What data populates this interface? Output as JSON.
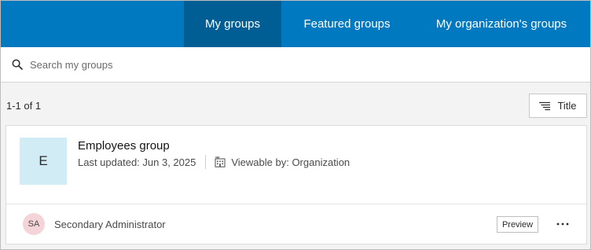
{
  "tabs": [
    {
      "label": "My groups",
      "active": true
    },
    {
      "label": "Featured groups",
      "active": false
    },
    {
      "label": "My organization's groups",
      "active": false
    }
  ],
  "search": {
    "placeholder": "Search my groups",
    "value": "",
    "icon": "search-icon"
  },
  "results": {
    "count_text": "1-1 of 1",
    "sort_label": "Title",
    "sort_icon": "sort-lines-icon"
  },
  "group": {
    "thumbnail_letter": "E",
    "title": "Employees group",
    "last_updated": "Last updated: Jun 3, 2025",
    "viewable": "Viewable by: Organization",
    "viewable_icon": "organization-building-icon",
    "owner_initials": "SA",
    "owner_name": "Secondary Administrator",
    "preview_label": "Preview",
    "more_icon": "ellipsis-icon"
  },
  "colors": {
    "tabbar": "#0079c1",
    "tab_active": "#005e95",
    "thumbnail_bg": "#d2ecf6",
    "avatar_bg": "#f4d4d9"
  }
}
